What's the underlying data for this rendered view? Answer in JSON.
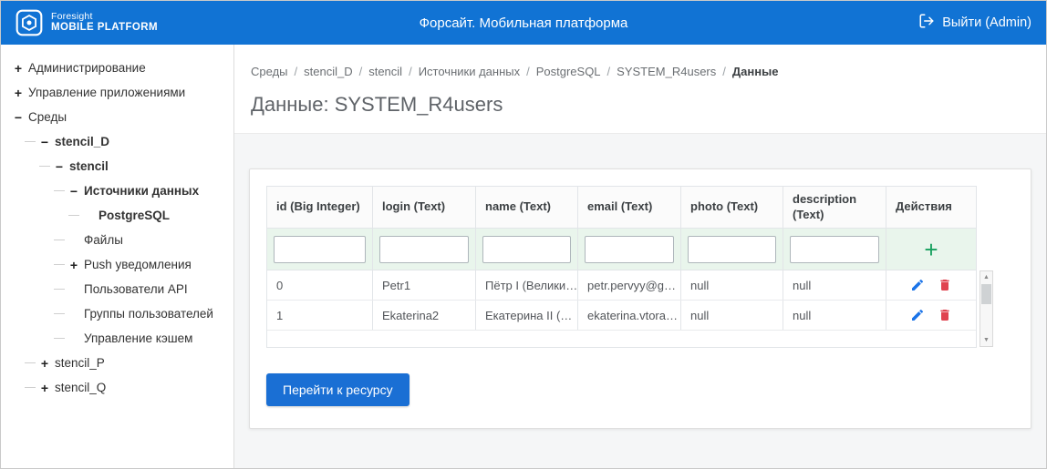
{
  "colors": {
    "header_blue": "#1173d4",
    "button_blue": "#1a6fd4",
    "add_green": "#17a05e",
    "edit_blue": "#1a73e8",
    "delete_red": "#e04350",
    "filter_row_green": "#e9f5ec"
  },
  "header": {
    "logo_line1": "Foresight",
    "logo_line2": "MOBILE PLATFORM",
    "title": "Форсайт. Мобильная платформа",
    "logout": "Выйти (Admin)"
  },
  "sidebar": {
    "items": [
      {
        "label": "Администрирование",
        "toggle": "+",
        "level": 0,
        "bold": false
      },
      {
        "label": "Управление приложениями",
        "toggle": "+",
        "level": 0,
        "bold": false
      },
      {
        "label": "Среды",
        "toggle": "−",
        "level": 0,
        "bold": false
      },
      {
        "label": "stencil_D",
        "toggle": "−",
        "level": 1,
        "bold": true
      },
      {
        "label": "stencil",
        "toggle": "−",
        "level": 2,
        "bold": true
      },
      {
        "label": "Источники данных",
        "toggle": "−",
        "level": 3,
        "bold": true
      },
      {
        "label": "PostgreSQL",
        "toggle": "",
        "level": 4,
        "bold": true
      },
      {
        "label": "Файлы",
        "toggle": "",
        "level": 3,
        "bold": false
      },
      {
        "label": "Push уведомления",
        "toggle": "+",
        "level": 3,
        "bold": false
      },
      {
        "label": "Пользователи API",
        "toggle": "",
        "level": 3,
        "bold": false
      },
      {
        "label": "Группы пользователей",
        "toggle": "",
        "level": 3,
        "bold": false
      },
      {
        "label": "Управление кэшем",
        "toggle": "",
        "level": 3,
        "bold": false
      },
      {
        "label": "stencil_P",
        "toggle": "+",
        "level": 1,
        "bold": false
      },
      {
        "label": "stencil_Q",
        "toggle": "+",
        "level": 1,
        "bold": false
      }
    ]
  },
  "breadcrumb": {
    "separator": "/",
    "items": [
      "Среды",
      "stencil_D",
      "stencil",
      "Источники данных",
      "PostgreSQL",
      "SYSTEM_R4users",
      "Данные"
    ]
  },
  "page": {
    "title": "Данные: SYSTEM_R4users"
  },
  "table": {
    "columns": [
      "id (Big Integer)",
      "login (Text)",
      "name (Text)",
      "email (Text)",
      "photo (Text)",
      "description (Text)",
      "Действия"
    ],
    "add_label": "+",
    "rows": [
      {
        "cells": [
          "0",
          "Petr1",
          "Пётр I (Велики…",
          "petr.pervyy@g…",
          "null",
          "null"
        ]
      },
      {
        "cells": [
          "1",
          "Ekaterina2",
          "Екатерина II (…",
          "ekaterina.vtora…",
          "null",
          "null"
        ]
      }
    ]
  },
  "button": {
    "label": "Перейти к ресурсу"
  },
  "ui": {
    "scroll_up": "▲",
    "scroll_down": "▼"
  }
}
